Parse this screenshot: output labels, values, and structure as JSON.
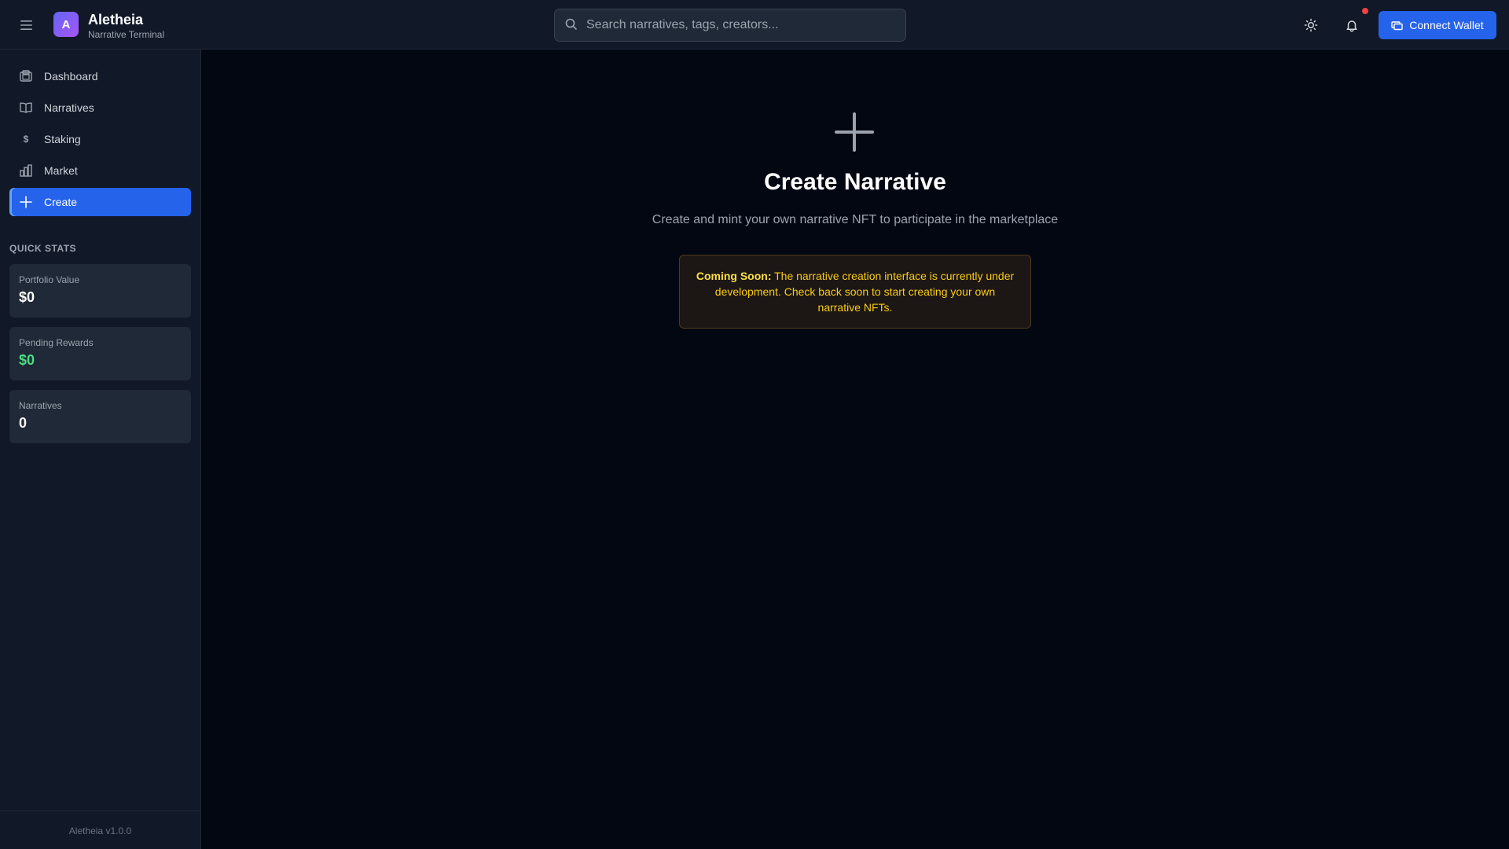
{
  "header": {
    "logo_letter": "A",
    "brand_title": "Aletheia",
    "brand_subtitle": "Narrative Terminal",
    "search_placeholder": "Search narratives, tags, creators...",
    "connect_wallet_label": "Connect Wallet"
  },
  "sidebar": {
    "items": [
      {
        "label": "Dashboard",
        "icon": "dashboard-icon"
      },
      {
        "label": "Narratives",
        "icon": "book-icon"
      },
      {
        "label": "Staking",
        "icon": "dollar-icon"
      },
      {
        "label": "Market",
        "icon": "bar-chart-icon"
      },
      {
        "label": "Create",
        "icon": "plus-icon",
        "active": true
      }
    ],
    "quick_stats_title": "QUICK STATS",
    "stats": [
      {
        "label": "Portfolio Value",
        "value": "$0"
      },
      {
        "label": "Pending Rewards",
        "value": "$0"
      },
      {
        "label": "Narratives",
        "value": "0"
      }
    ],
    "footer": "Aletheia v1.0.0"
  },
  "main": {
    "title": "Create Narrative",
    "subtitle": "Create and mint your own narrative NFT to participate in the marketplace",
    "notice_strong": "Coming Soon:",
    "notice_text": " The narrative creation interface is currently under development. Check back soon to start creating your own narrative NFTs."
  },
  "colors": {
    "accent": "#2563eb",
    "notification_dot": "#ef4444",
    "rewards_green": "#4ade80",
    "notice_text": "#facc15"
  }
}
